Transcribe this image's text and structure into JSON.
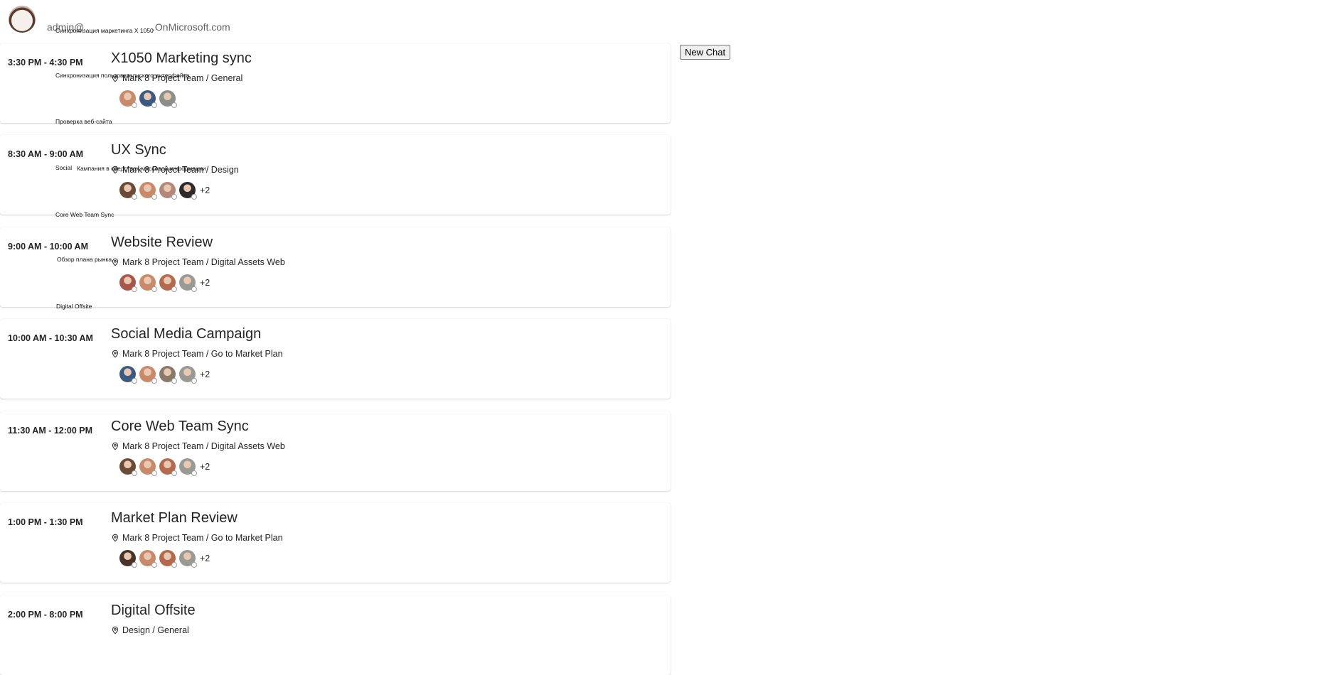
{
  "header": {
    "user_prefix": "admin@",
    "user_domain": ".OnMicrosoft.com",
    "new_chat_label": "New Chat"
  },
  "overlay_labels": [
    "Синхронизация маркетинга X 1050",
    "Синхронизация пользовательского интерфейса",
    "Проверка веб-сайта",
    "Social",
    "Кампания в средствах массовой информации",
    "Core Web Team Sync",
    "Обзор плана рынка",
    "Digital Offsite"
  ],
  "meetings": [
    {
      "time": "3:30 PM - 4:30 PM",
      "title": "X1050 Marketing sync",
      "location": "Mark 8 Project Team / General",
      "avatars": [
        "#c98a6a",
        "#3b5a82",
        "#8a8f88"
      ],
      "more": ""
    },
    {
      "time": "8:30 AM - 9:00 AM",
      "title": "UX Sync",
      "location": "Mark 8 Project Team / Design",
      "avatars": [
        "#6b4a36",
        "#c98a6a",
        "#b5877a",
        "#2e2a2a"
      ],
      "more": "+2"
    },
    {
      "time": "9:00 AM - 10:00 AM",
      "title": "Website Review",
      "location": "Mark 8 Project Team / Digital Assets Web",
      "avatars": [
        "#a8554a",
        "#c98a6a",
        "#b46a4c",
        "#9a9a94"
      ],
      "more": "+2"
    },
    {
      "time": "10:00 AM - 10:30 AM",
      "title": "Social Media Campaign",
      "location": "Mark 8 Project Team / Go to Market Plan",
      "avatars": [
        "#3b5a82",
        "#c98a6a",
        "#8a7a6a",
        "#9a9a94"
      ],
      "more": "+2"
    },
    {
      "time": "11:30 AM - 12:00 PM",
      "title": "Core Web Team Sync",
      "location": "Mark 8 Project Team / Digital Assets Web",
      "avatars": [
        "#6b4a36",
        "#c98a6a",
        "#b46a4c",
        "#9a9a94"
      ],
      "more": "+2"
    },
    {
      "time": "1:00 PM - 1:30 PM",
      "title": "Market Plan Review",
      "location": "Mark 8 Project Team / Go to Market Plan",
      "avatars": [
        "#4a3428",
        "#c98a6a",
        "#b46a4c",
        "#9a9a94"
      ],
      "more": "+2"
    },
    {
      "time": "2:00 PM - 8:00 PM",
      "title": "Digital Offsite",
      "location": "Design / General",
      "avatars": [],
      "more": ""
    }
  ]
}
